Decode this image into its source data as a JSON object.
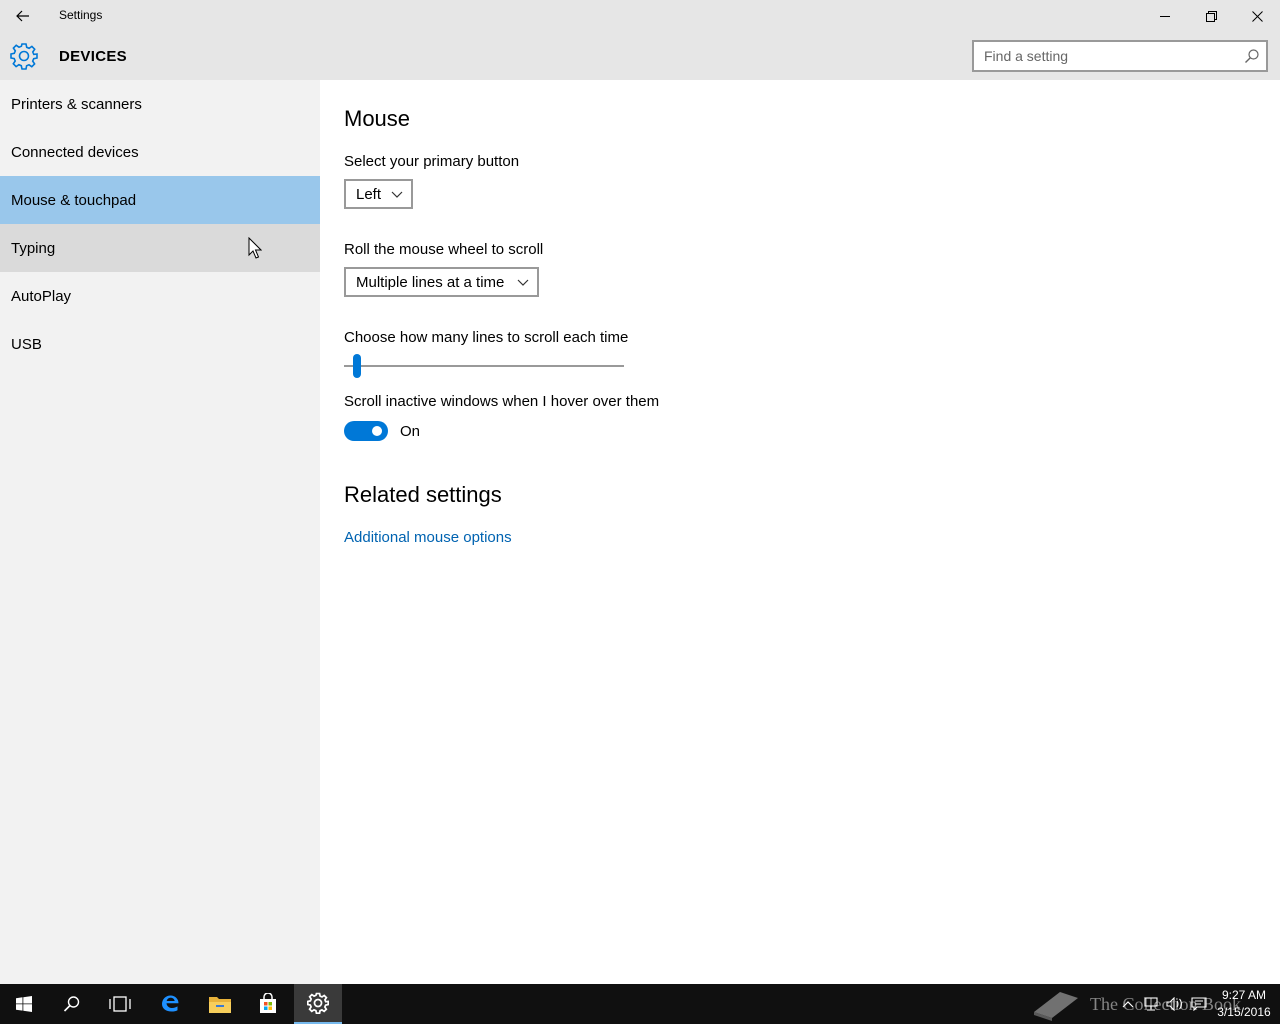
{
  "window": {
    "title": "Settings"
  },
  "header": {
    "title": "DEVICES",
    "search_placeholder": "Find a setting"
  },
  "sidebar": {
    "items": [
      {
        "label": "Printers & scanners"
      },
      {
        "label": "Connected devices"
      },
      {
        "label": "Mouse & touchpad"
      },
      {
        "label": "Typing"
      },
      {
        "label": "AutoPlay"
      },
      {
        "label": "USB"
      }
    ],
    "selected": "Mouse & touchpad",
    "hovered": "Typing"
  },
  "main": {
    "heading": "Mouse",
    "primary_button": {
      "label": "Select your primary button",
      "value": "Left"
    },
    "wheel_scroll": {
      "label": "Roll the mouse wheel to scroll",
      "value": "Multiple lines at a time"
    },
    "lines_slider": {
      "label": "Choose how many lines to scroll each time",
      "level": 0.02
    },
    "inactive_scroll": {
      "label": "Scroll inactive windows when I hover over them",
      "state": "On"
    },
    "related": {
      "heading": "Related settings",
      "link": "Additional mouse options"
    }
  },
  "taskbar": {
    "time": "9:27 AM",
    "date": "3/15/2016",
    "watermark": "The Collection Book"
  },
  "colors": {
    "accent": "#0078d7",
    "selected_nav": "#99c7eb",
    "link": "#0063b1"
  }
}
